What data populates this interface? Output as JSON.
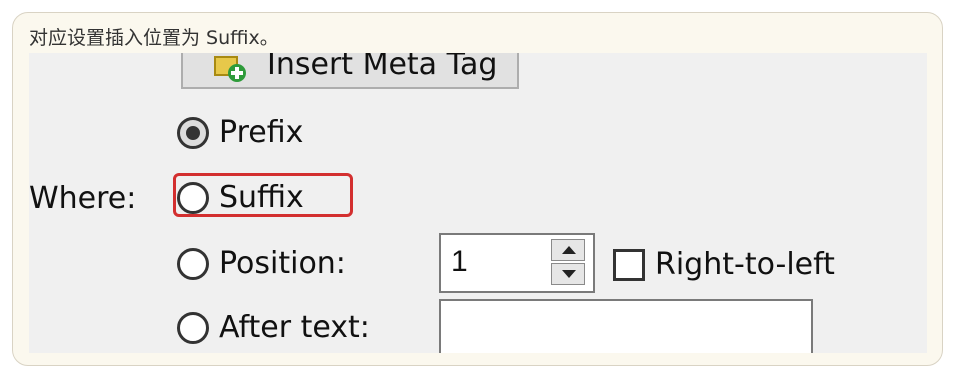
{
  "caption": "对应设置插入位置为 Suffix。",
  "dialog": {
    "insert_button_label": "Insert Meta Tag",
    "where_label": "Where:",
    "options": [
      {
        "label": "Prefix",
        "checked": true
      },
      {
        "label": "Suffix",
        "checked": false
      },
      {
        "label": "Position:",
        "checked": false
      },
      {
        "label": "After text:",
        "checked": false
      }
    ],
    "position_value": "1",
    "rtl_label": "Right-to-left",
    "rtl_checked": false,
    "after_text_value": ""
  },
  "colors": {
    "highlight": "#d32f2f",
    "dialog_bg": "#f0f0f0",
    "card_bg": "#fbf8ee"
  }
}
